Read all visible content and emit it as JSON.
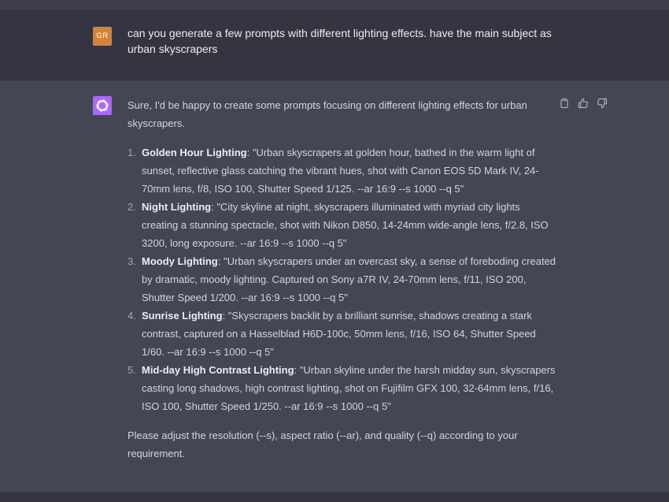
{
  "user_message": {
    "avatar_initials": "GR",
    "text": "can you generate a few prompts with different lighting effects. have the main subject as urban skyscrapers"
  },
  "assistant_message": {
    "intro": "Sure, I'd be happy to create some prompts focusing on different lighting effects for urban skyscrapers.",
    "items": [
      {
        "number": "1.",
        "title": "Golden Hour Lighting",
        "text": ": \"Urban skyscrapers at golden hour, bathed in the warm light of sunset, reflective glass catching the vibrant hues, shot with Canon EOS 5D Mark IV, 24-70mm lens, f/8, ISO 100, Shutter Speed 1/125. --ar 16:9 --s 1000 --q 5\""
      },
      {
        "number": "2.",
        "title": "Night Lighting",
        "text": ": \"City skyline at night, skyscrapers illuminated with myriad city lights creating a stunning spectacle, shot with Nikon D850, 14-24mm wide-angle lens, f/2.8, ISO 3200, long exposure. --ar 16:9 --s 1000 --q 5\""
      },
      {
        "number": "3.",
        "title": "Moody Lighting",
        "text": ": \"Urban skyscrapers under an overcast sky, a sense of foreboding created by dramatic, moody lighting. Captured on Sony a7R IV, 24-70mm lens, f/11, ISO 200, Shutter Speed 1/200. --ar 16:9 --s 1000 --q 5\""
      },
      {
        "number": "4.",
        "title": "Sunrise Lighting",
        "text": ": \"Skyscrapers backlit by a brilliant sunrise, shadows creating a stark contrast, captured on a Hasselblad H6D-100c, 50mm lens, f/16, ISO 64, Shutter Speed 1/60. --ar 16:9 --s 1000 --q 5\""
      },
      {
        "number": "5.",
        "title": "Mid-day High Contrast Lighting",
        "text": ": \"Urban skyline under the harsh midday sun, skyscrapers casting long shadows, high contrast lighting, shot on Fujifilm GFX 100, 32-64mm lens, f/16, ISO 100, Shutter Speed 1/250. --ar 16:9 --s 1000 --q 5\""
      }
    ],
    "closing": "Please adjust the resolution (--s), aspect ratio (--ar), and quality (--q) according to your requirement.",
    "actions": {
      "copy_icon": "clipboard-icon",
      "like_icon": "thumbs-up-icon",
      "dislike_icon": "thumbs-down-icon"
    }
  },
  "colors": {
    "user_bg": "#343541",
    "assistant_bg": "#444654",
    "user_avatar": "#d4843a",
    "bot_avatar": "#ab68ff",
    "text": "#d1d5db"
  }
}
